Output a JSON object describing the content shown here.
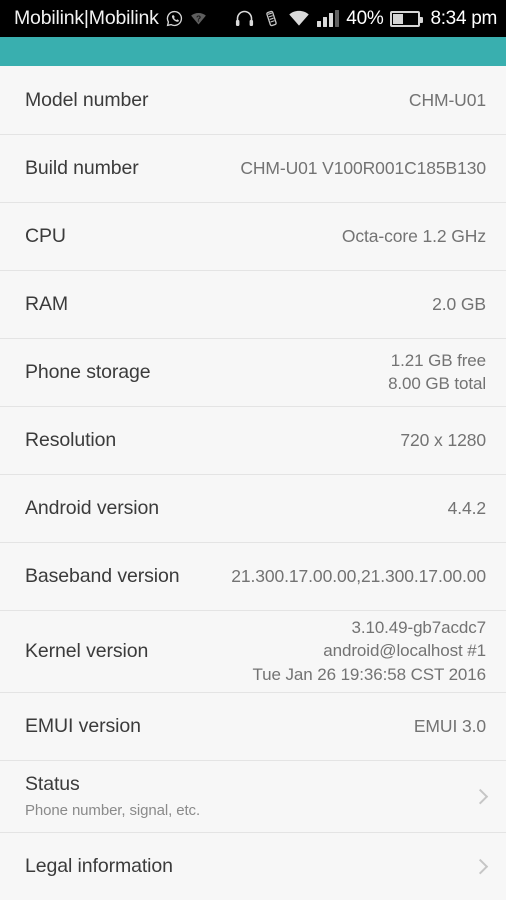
{
  "statusbar": {
    "carrier": "Mobilink|Mobilink",
    "icons": [
      "whatsapp-icon",
      "wifi-question-icon",
      "headphones-icon",
      "vibrate-icon",
      "wifi-icon",
      "signal-bars-icon"
    ],
    "battery_percent": "40%",
    "time": "8:34 pm"
  },
  "appbar": {
    "accent_color": "#39afaf"
  },
  "colors": {
    "background": "#f7f7f7",
    "label": "#3b3b3b",
    "value": "#737373",
    "divider": "#e4e4e4",
    "chevron": "#c6c6c6",
    "statusbar_bg": "#000000"
  },
  "list": {
    "rows": [
      {
        "label": "Model number",
        "value": "CHM-U01",
        "chevron": false
      },
      {
        "label": "Build number",
        "value": "CHM-U01 V100R001C185B130",
        "chevron": false
      },
      {
        "label": "CPU",
        "value": "Octa-core 1.2 GHz",
        "chevron": false
      },
      {
        "label": "RAM",
        "value": "2.0 GB",
        "chevron": false
      },
      {
        "label": "Phone storage",
        "value": "1.21  GB free\n8.00  GB total",
        "chevron": false
      },
      {
        "label": "Resolution",
        "value": "720 x 1280",
        "chevron": false
      },
      {
        "label": "Android version",
        "value": "4.4.2",
        "chevron": false
      },
      {
        "label": "Baseband version",
        "value": "21.300.17.00.00,21.300.17.00.00",
        "chevron": false
      },
      {
        "label": "Kernel version",
        "value": "3.10.49-gb7acdc7\nandroid@localhost #1\nTue Jan 26 19:36:58 CST 2016",
        "chevron": false
      },
      {
        "label": "EMUI version",
        "value": "EMUI 3.0",
        "chevron": false
      },
      {
        "label": "Status",
        "sub": "Phone number, signal, etc.",
        "value": "",
        "chevron": true
      },
      {
        "label": "Legal information",
        "value": "",
        "chevron": true
      }
    ]
  }
}
